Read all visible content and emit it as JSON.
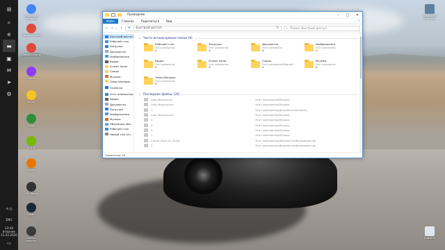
{
  "desktop": {
    "icons_left": [
      {
        "label": "Chrome for Windows",
        "color": "#4285f4"
      },
      {
        "label": "Google Chrome",
        "color": "#e04a3a"
      },
      {
        "label": "Google Chrome",
        "color": "#e04a3a"
      },
      {
        "label": "ShareX",
        "color": "#8a3cff"
      },
      {
        "label": "Emoji",
        "color": "#f3c623"
      },
      {
        "label": "Snagit",
        "color": "#2d8f3c"
      },
      {
        "label": "NVIDIA",
        "color": "#76b900"
      },
      {
        "label": "Blender",
        "color": "#ea7600"
      },
      {
        "label": "OBS Studio",
        "color": "#333333"
      },
      {
        "label": "Steam",
        "color": "#1b2838"
      },
      {
        "label": "DaVinci Resolve",
        "color": "#3a3a3a"
      }
    ],
    "icons_right": [
      {
        "label": "Shadow PC Launcher",
        "color": "#5f7fa0"
      },
      {
        "label": "Корзина",
        "color": "#dfe6ee"
      }
    ]
  },
  "taskbar": {
    "apps": [
      {
        "name": "start",
        "glyph": "⊞"
      },
      {
        "name": "search",
        "glyph": "⌕"
      },
      {
        "name": "task-view",
        "glyph": "❐"
      },
      {
        "name": "edge",
        "glyph": "e"
      },
      {
        "name": "explorer",
        "glyph": "▬"
      },
      {
        "name": "store",
        "glyph": "▣"
      },
      {
        "name": "mail",
        "glyph": "✉"
      },
      {
        "name": "telegram",
        "glyph": "➤"
      },
      {
        "name": "settings",
        "glyph": "⚙"
      }
    ],
    "language": "ENG",
    "time": "13:44",
    "day": "вторник",
    "date": "11.02.2020"
  },
  "window": {
    "title": "Проводник",
    "ribbon_tabs": [
      "Файл",
      "Главная",
      "Поделиться",
      "Вид"
    ],
    "address": "Быстрый доступ",
    "search_placeholder": "Поиск: Быстрый доступ",
    "sidebar": [
      {
        "label": "Быстрый доступ",
        "selected": true,
        "icon": "#2b7de0"
      },
      {
        "label": "Рабочий стол",
        "icon": "#3f8fdc"
      },
      {
        "label": "Загрузки",
        "icon": "#2b7de0"
      },
      {
        "label": "Документы",
        "icon": "#9aa7b4"
      },
      {
        "label": "Изображения",
        "icon": "#4c9bd6"
      },
      {
        "label": "Видео",
        "icon": "#5a5a5a"
      },
      {
        "label": "Screen Saver",
        "icon": "#ffd35c"
      },
      {
        "label": "Гряцы",
        "icon": "#ffd35c"
      },
      {
        "label": "Музыка",
        "icon": "#d06a2c"
      },
      {
        "label": "Темы Windows",
        "icon": "#ffd35c"
      },
      {
        "label": "OneDrive",
        "icon": "#1e74d2",
        "gap": true
      },
      {
        "label": "Этот компьютер",
        "icon": "#4a7fb5",
        "gap": true
      },
      {
        "label": "Видео",
        "icon": "#5a5a5a"
      },
      {
        "label": "Документы",
        "icon": "#9aa7b4"
      },
      {
        "label": "Загрузки",
        "icon": "#2b7de0"
      },
      {
        "label": "Изображения",
        "icon": "#4c9bd6"
      },
      {
        "label": "Музыка",
        "icon": "#d06a2c"
      },
      {
        "label": "Объемные объ",
        "icon": "#66a8e0"
      },
      {
        "label": "Рабочий стол",
        "icon": "#3f8fdc"
      },
      {
        "label": "Новый том (D:)",
        "icon": "#8a8a8a"
      }
    ],
    "frequent_header": "Часто используемые папки (9)",
    "frequent": [
      {
        "name": "Рабочий стол",
        "sub": "Этот компьютер"
      },
      {
        "name": "Загрузки",
        "sub": "Этот компьютер"
      },
      {
        "name": "Документы",
        "sub": "Этот компьютер"
      },
      {
        "name": "Изображения",
        "sub": "Этот компьютер"
      },
      {
        "name": "Видео",
        "sub": "Этот компьютер"
      },
      {
        "name": "Screen Saver",
        "sub": "Этот компьютер"
      },
      {
        "name": "Гряцы",
        "sub": "Этот компьютер\\Рабочий..."
      },
      {
        "name": "Музыка",
        "sub": "Этот компьютер"
      },
      {
        "name": "Темы Windows",
        "sub": "Этот компьютер"
      }
    ],
    "recent_header": "Последние файлы (20)",
    "recent": [
      {
        "name": "Lata_Motorcycle",
        "path": "Этот компьютер\\Музыка"
      },
      {
        "name": "Lata_Motorcycle1",
        "path": "Этот компьютер\\Музыка"
      },
      {
        "name": "1",
        "path": "Этот компьютер\\Документы\\Audacity"
      },
      {
        "name": "Lata_Motorcycle1",
        "path": "Этот компьютер\\Музыка"
      },
      {
        "name": "4",
        "path": "Этот компьютер\\Музыка"
      },
      {
        "name": "3",
        "path": "Этот компьютер\\Музыка"
      },
      {
        "name": "2",
        "path": "Этот компьютер\\Музыка"
      },
      {
        "name": "1",
        "path": "Этот компьютер\\Музыка"
      },
      {
        "name": "Canva_Zoro_01_Quad",
        "path": "Этот компьютер\\Документы\\Фоторедактор"
      },
      {
        "name": "1",
        "path": "Этот компьютер\\Документы\\Фоторедактор"
      }
    ],
    "status": "Элементов: 29"
  }
}
